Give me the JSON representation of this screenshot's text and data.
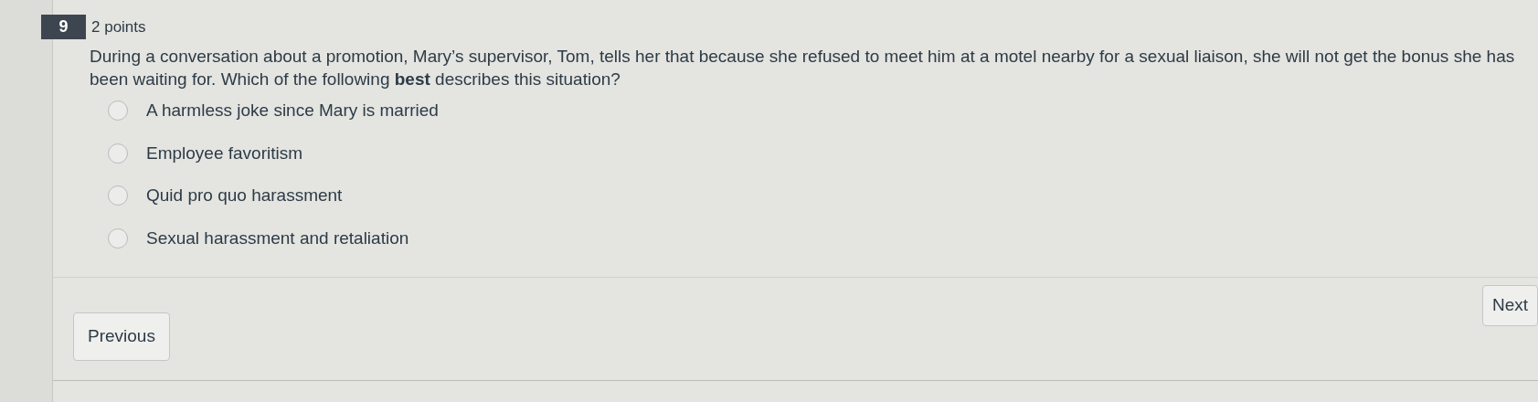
{
  "question": {
    "number": "9",
    "points": "2 points",
    "text": "During a conversation about a promotion, Mary’s supervisor, Tom, tells her that because she refused to meet him at a motel nearby for a sexual liaison, she will not get the bonus she has been waiting for. Which of the following **best** describes this situation?"
  },
  "options": [
    {
      "label": "A harmless joke since Mary is married",
      "selected": false
    },
    {
      "label": "Employee favoritism",
      "selected": false
    },
    {
      "label": "Quid pro quo harassment",
      "selected": false
    },
    {
      "label": "Sexual harassment and retaliation",
      "selected": false
    }
  ],
  "buttons": {
    "next": "Next",
    "previous": "Previous"
  }
}
